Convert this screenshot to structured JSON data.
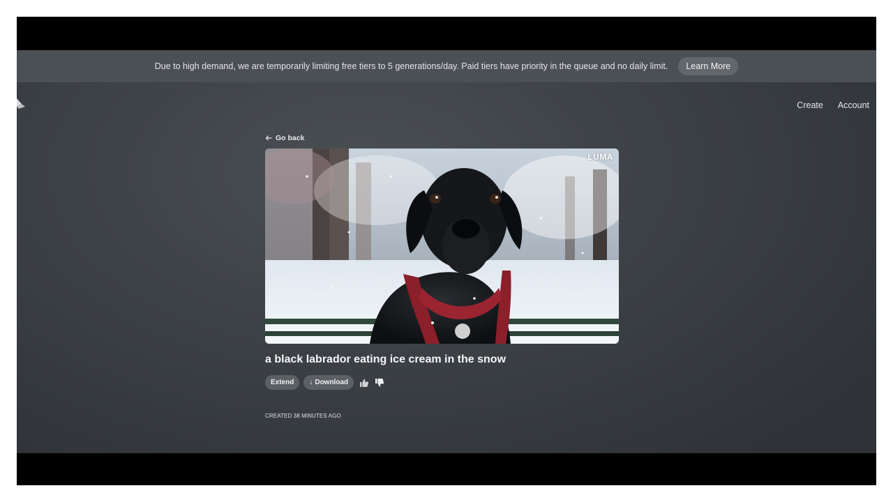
{
  "banner": {
    "message": "Due to high demand, we are temporarily limiting free tiers to 5 generations/day. Paid tiers have priority in the queue and no daily limit.",
    "learn_more_label": "Learn More"
  },
  "nav": {
    "create_label": "Create",
    "account_label": "Account"
  },
  "detail": {
    "back_label": "Go back",
    "watermark": "LUMA",
    "title": "a black labrador eating ice cream in the snow",
    "extend_label": "Extend",
    "download_label": "Download",
    "download_icon": "↓",
    "created_label": "CREATED 38 MINUTES AGO"
  },
  "icons": {
    "logo": "luma-logo-icon",
    "back": "arrow-left-icon",
    "download": "download-arrow-icon",
    "like": "thumbs-up-icon",
    "dislike": "thumbs-down-icon"
  },
  "colors": {
    "page_background": "#3d4247",
    "banner_background": "#4b5055",
    "pill_background": "#5b6065",
    "text": "#f5f6f7"
  }
}
